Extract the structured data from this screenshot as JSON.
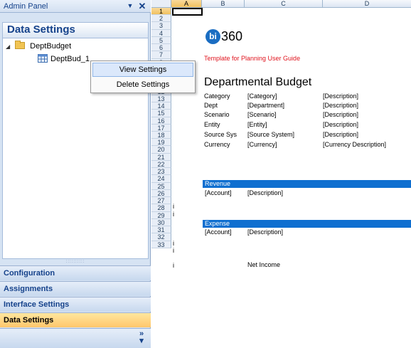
{
  "panel": {
    "title": "Admin Panel",
    "menu_arrow": "▼",
    "close": "✕",
    "section_title": "Data Settings",
    "tree": {
      "root_expander": "◢",
      "root_label": "DeptBudget",
      "child_label": "DeptBud_1"
    },
    "splitter": "::::::::::",
    "nav": [
      {
        "label": "Configuration"
      },
      {
        "label": "Assignments"
      },
      {
        "label": "Interface Settings"
      },
      {
        "label": "Data Settings"
      }
    ],
    "more_glyph": "»"
  },
  "context_menu": {
    "items": [
      {
        "label": "View Settings"
      },
      {
        "label": "Delete Settings"
      }
    ]
  },
  "sheet": {
    "columns": [
      "A",
      "B",
      "C",
      "D"
    ],
    "rows": [
      "1",
      "2",
      "3",
      "4",
      "5",
      "6",
      "7",
      "8",
      "9",
      "10",
      "11",
      "12",
      "13",
      "14",
      "15",
      "16",
      "17",
      "18",
      "19",
      "20",
      "21",
      "22",
      "23",
      "24",
      "25",
      "26",
      "27",
      "28",
      "29",
      "30",
      "31",
      "32",
      "33"
    ],
    "logo_mark": "bi",
    "logo_number": "360",
    "subtitle": "Template for Planning User Guide",
    "title": "Departmental Budget",
    "params": [
      {
        "label": "Category",
        "value": "[Category]",
        "desc": "[Description]"
      },
      {
        "label": "Dept",
        "value": "[Department]",
        "desc": "[Description]"
      },
      {
        "label": "Scenario",
        "value": "[Scenario]",
        "desc": "[Description]"
      },
      {
        "label": "Entity",
        "value": "[Entity]",
        "desc": "[Description]"
      },
      {
        "label": "Source Sys",
        "value": "[Source System]",
        "desc": "[Description]"
      },
      {
        "label": "Currency",
        "value": "[Currency]",
        "desc": "[Currency Description]"
      }
    ],
    "revenue": {
      "band": "Revenue",
      "account": "[Account]",
      "desc": "[Description]"
    },
    "expense": {
      "band": "Expense",
      "account": "[Account]",
      "desc": "[Description]"
    },
    "net_income": "Net Income",
    "edge_mark": "i"
  },
  "colors": {
    "panel_bg": "#d6e3f3",
    "panel_text": "#15428b",
    "selected_nav": "#ffc66b",
    "band_blue": "#0f6fd0",
    "subtitle_red": "#e0141e",
    "logo_blue": "#1a6dc2"
  }
}
